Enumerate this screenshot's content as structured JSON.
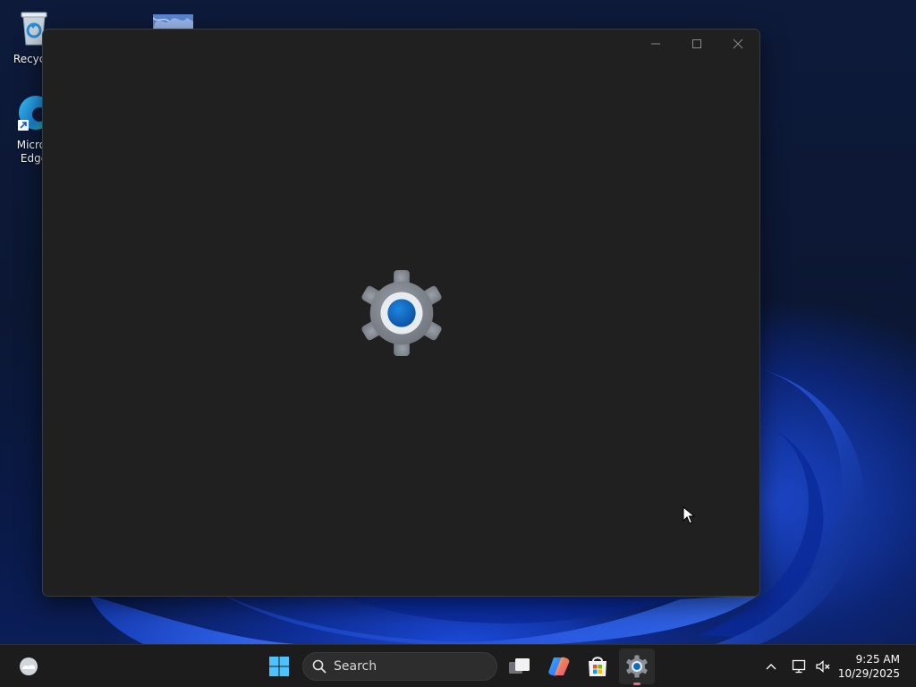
{
  "desktop": {
    "icons": [
      {
        "label": "Recycle",
        "icon": "recycle-bin-icon"
      },
      {
        "label": "Micros",
        "label2": "Edge",
        "icon": "edge-icon"
      },
      {
        "label": "",
        "icon": "image-file-icon"
      }
    ]
  },
  "window": {
    "controls": {
      "minimize": "─",
      "maximize": "□",
      "close": "✕"
    },
    "splash_icon": "settings-gear-icon"
  },
  "taskbar": {
    "widgets_icon": "weather-widget-icon",
    "start_icon": "windows-start-icon",
    "search": {
      "placeholder": "Search"
    },
    "apps": [
      {
        "name": "task-view",
        "icon": "task-view-icon"
      },
      {
        "name": "copilot",
        "icon": "copilot-icon"
      },
      {
        "name": "microsoft-store",
        "icon": "store-icon"
      },
      {
        "name": "settings",
        "icon": "settings-icon",
        "active": true
      }
    ],
    "tray": {
      "overflow_icon": "chevron-up-icon",
      "network_icon": "network-icon",
      "volume_icon": "volume-muted-icon"
    },
    "clock": {
      "time": "9:25 AM",
      "date": "10/29/2025"
    }
  },
  "colors": {
    "window_bg": "#202020",
    "taskbar_bg": "#1c1c1c",
    "accent_blue": "#0f6cbd",
    "gear_gray": "#7b8088"
  }
}
